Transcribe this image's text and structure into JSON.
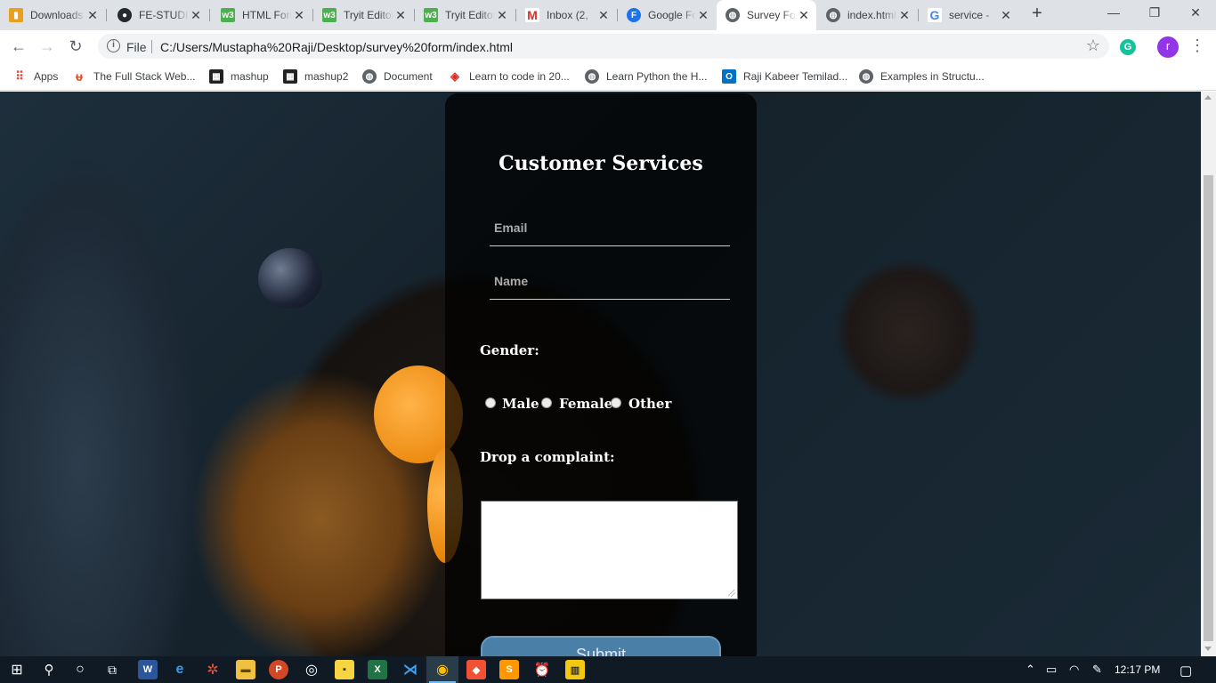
{
  "browser": {
    "tabs": [
      {
        "title": "Downloads",
        "icon": "chart-favicon",
        "color": "#e8a020"
      },
      {
        "title": "FE-STUDIO",
        "icon": "github-favicon",
        "color": "#24292e"
      },
      {
        "title": "HTML Forms",
        "icon": "w3-favicon",
        "color": "#4caf50"
      },
      {
        "title": "Tryit Editor",
        "icon": "w3-favicon",
        "color": "#4caf50"
      },
      {
        "title": "Tryit Editor",
        "icon": "w3-favicon",
        "color": "#4caf50"
      },
      {
        "title": "Inbox (2,",
        "icon": "gmail-favicon",
        "color": "#d93025"
      },
      {
        "title": "Google Forms",
        "icon": "f-favicon",
        "color": "#1a73e8"
      },
      {
        "title": "Survey Form",
        "icon": "globe-favicon",
        "color": "#5f6368",
        "active": true
      },
      {
        "title": "index.html",
        "icon": "globe-favicon",
        "color": "#5f6368"
      },
      {
        "title": "service -",
        "icon": "google-favicon",
        "color": "#4285f4"
      }
    ],
    "new_tab_glyph": "+",
    "window_controls": {
      "minimize": "—",
      "restore": "❐",
      "close": "✕"
    },
    "address": {
      "scheme_label": "File",
      "url": "C:/Users/Mustapha%20Raji/Desktop/survey%20form/index.html"
    },
    "avatar_letter": "r",
    "extension_letter": "G",
    "bookmarks": [
      {
        "label": "Apps",
        "icon": "apps-grid-icon"
      },
      {
        "label": "The Full Stack Web...",
        "icon": "fullstack-favicon"
      },
      {
        "label": "mashup",
        "icon": "mashup-favicon"
      },
      {
        "label": "mashup2",
        "icon": "mashup-favicon"
      },
      {
        "label": "Document",
        "icon": "globe-favicon"
      },
      {
        "label": "Learn to code in 20...",
        "icon": "code-favicon"
      },
      {
        "label": "Learn Python the H...",
        "icon": "globe-favicon"
      },
      {
        "label": "Raji Kabeer Temilad...",
        "icon": "outlook-favicon"
      },
      {
        "label": "Examples in Structu...",
        "icon": "globe-favicon"
      }
    ]
  },
  "form": {
    "title": "Customer Services",
    "email_placeholder": "Email",
    "name_placeholder": "Name",
    "gender_label": "Gender:",
    "gender_options": [
      "Male",
      "Female",
      "Other"
    ],
    "complaint_label": "Drop a complaint:",
    "submit_label": "Submit"
  },
  "taskbar": {
    "apps": [
      "windows-start-icon",
      "search-icon",
      "cortana-icon",
      "task-view-icon",
      "word-icon",
      "edge-icon",
      "settings-gear-icon",
      "file-explorer-icon",
      "powerpoint-icon",
      "media-icon",
      "sticky-notes-icon",
      "excel-icon",
      "vscode-icon",
      "chrome-icon",
      "git-icon",
      "sublime-icon",
      "alarm-icon",
      "monitor-icon"
    ],
    "time": "12:17 PM"
  }
}
